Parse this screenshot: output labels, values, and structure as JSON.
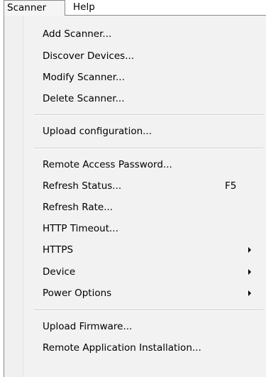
{
  "menubar": {
    "scanner_label": "Scanner",
    "help_label": "Help"
  },
  "menu": {
    "add_scanner": "Add Scanner...",
    "discover_devices": "Discover Devices...",
    "modify_scanner": "Modify Scanner...",
    "delete_scanner": "Delete Scanner...",
    "upload_configuration": "Upload configuration...",
    "remote_access_password": "Remote Access Password...",
    "refresh_status": "Refresh Status...",
    "refresh_status_shortcut": "F5",
    "refresh_rate": "Refresh Rate...",
    "http_timeout": "HTTP Timeout...",
    "https": "HTTPS",
    "device": "Device",
    "power_options": "Power Options",
    "upload_firmware": "Upload Firmware...",
    "remote_application_installation": "Remote Application Installation..."
  },
  "icons": {
    "submenu_arrow": "chevron-right-icon"
  }
}
